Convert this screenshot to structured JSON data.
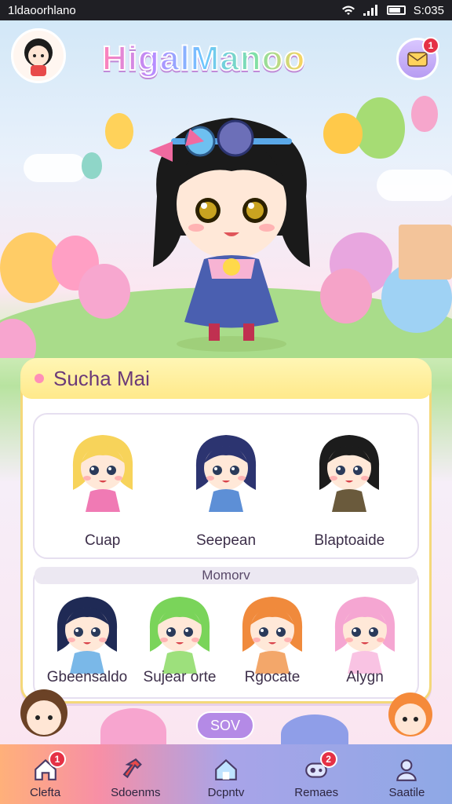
{
  "status_bar": {
    "carrier": "1ldaoorhlano",
    "time": "S:035"
  },
  "header": {
    "game_title": "HigalManoo",
    "notification_count": "1"
  },
  "panel": {
    "title": "Sucha Mai",
    "featured": [
      {
        "name": "Cuap",
        "hair": "#f7d35a",
        "dress": "#f07ab4"
      },
      {
        "name": "Seepean",
        "hair": "#2c3470",
        "dress": "#5d8fd6"
      },
      {
        "name": "Blaptoaide",
        "hair": "#1c1c1c",
        "dress": "#6a5a3c"
      }
    ],
    "section_label": "Momorv",
    "members": [
      {
        "name": "Gbeensaldo",
        "hair": "#1f2a55",
        "dress": "#7ab8e8"
      },
      {
        "name": "Sujear orte",
        "hair": "#7ad45a",
        "dress": "#9de07c"
      },
      {
        "name": "Rgocate",
        "hair": "#f08a3c",
        "dress": "#f3a76a"
      },
      {
        "name": "Alygn",
        "hair": "#f5a6d2",
        "dress": "#f9c3e3"
      }
    ]
  },
  "action_button": "SOV",
  "tabs": [
    {
      "label": "Clefta",
      "icon": "home-icon",
      "badge": "1"
    },
    {
      "label": "Sdoenms",
      "icon": "hammer-icon",
      "badge": ""
    },
    {
      "label": "Dcpntv",
      "icon": "house-icon",
      "badge": ""
    },
    {
      "label": "Remaes",
      "icon": "gamepad-icon",
      "badge": "2"
    },
    {
      "label": "Saatile",
      "icon": "profile-icon",
      "badge": ""
    }
  ]
}
